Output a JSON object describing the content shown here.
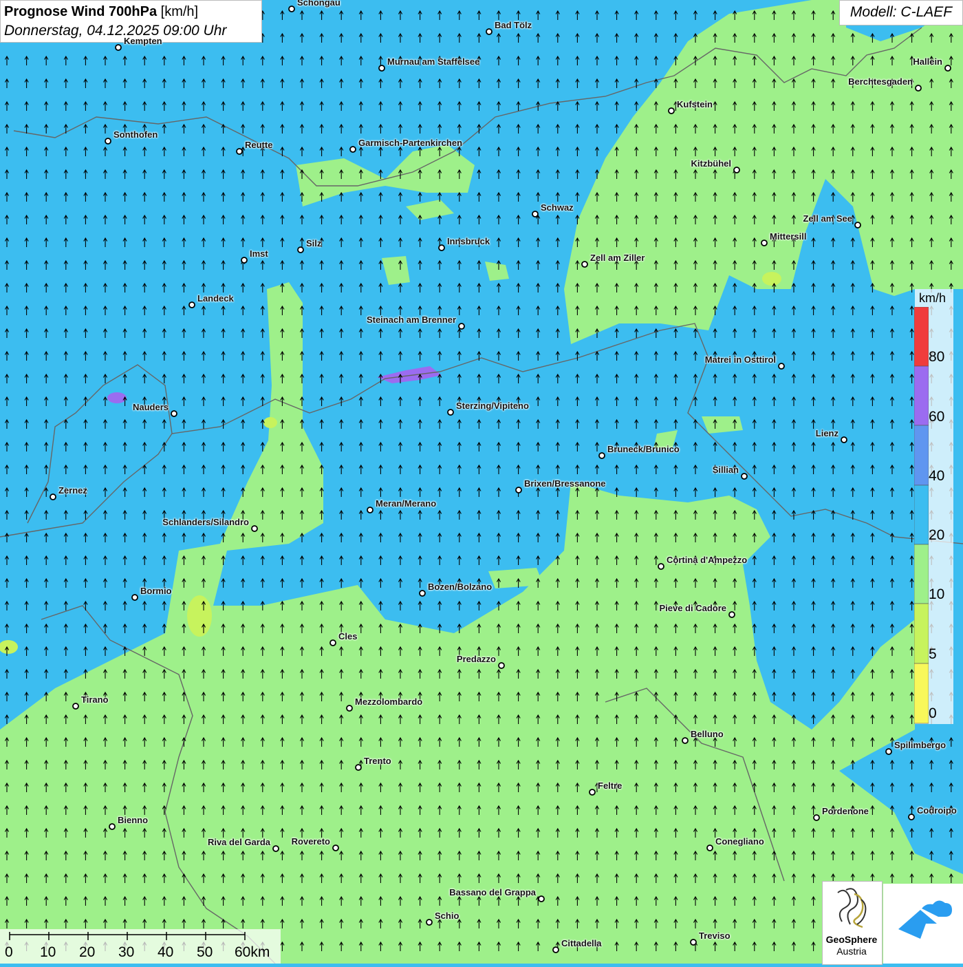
{
  "header": {
    "title_bold": "Prognose Wind 700hPa",
    "title_unit": "[km/h]",
    "subtitle": "Donnerstag, 04.12.2025 09:00 Uhr",
    "model": "Modell: C-LAEF"
  },
  "legend": {
    "unit": "km/h",
    "labels": [
      "80",
      "60",
      "40",
      "20",
      "10",
      "5",
      "0"
    ],
    "colors": {
      "0-5": "#f8f85a",
      "5-10": "#c7f35d",
      "10-20": "#9ef08a",
      "20-40": "#3cbdf0",
      "40-60": "#5f96f0",
      "60-80": "#9b6cf0",
      "80+": "#f03c3c"
    }
  },
  "scale_bar": {
    "labels": [
      "0",
      "10",
      "20",
      "30",
      "40",
      "50",
      "60km"
    ]
  },
  "logos": {
    "geosphere_line1": "GeoSphere",
    "geosphere_line2": "Austria",
    "geosphere_icon": "geosphere-swirl-icon",
    "partner_icon": "cloud-arrow-icon"
  },
  "cities": [
    {
      "name": "Schongau"
    },
    {
      "name": "Bad Tölz"
    },
    {
      "name": "Kempten"
    },
    {
      "name": "Murnau am Staffelsee"
    },
    {
      "name": "Hallein"
    },
    {
      "name": "Berchtesgaden"
    },
    {
      "name": "Kufstein"
    },
    {
      "name": "Sonthofen"
    },
    {
      "name": "Reutte"
    },
    {
      "name": "Garmisch-Partenkirchen"
    },
    {
      "name": "Kitzbühel"
    },
    {
      "name": "Schwaz"
    },
    {
      "name": "Zell am See"
    },
    {
      "name": "Mittersill"
    },
    {
      "name": "Innsbruck"
    },
    {
      "name": "Silz"
    },
    {
      "name": "Imst"
    },
    {
      "name": "Zell am Ziller"
    },
    {
      "name": "Landeck"
    },
    {
      "name": "Steinach am Brenner"
    },
    {
      "name": "Matrei in Osttirol"
    },
    {
      "name": "Nauders"
    },
    {
      "name": "Sterzing/Vipiteno"
    },
    {
      "name": "Lienz"
    },
    {
      "name": "Bruneck/Brunico"
    },
    {
      "name": "Sillian"
    },
    {
      "name": "Zernez"
    },
    {
      "name": "Brixen/Bressanone"
    },
    {
      "name": "Meran/Merano"
    },
    {
      "name": "Schlanders/Silandro"
    },
    {
      "name": "Cortina d'Ampezzo"
    },
    {
      "name": "Bormio"
    },
    {
      "name": "Bozen/Bolzano"
    },
    {
      "name": "Pieve di Cadore"
    },
    {
      "name": "Cles"
    },
    {
      "name": "Predazzo"
    },
    {
      "name": "Tirano"
    },
    {
      "name": "Mezzolombardo"
    },
    {
      "name": "Belluno"
    },
    {
      "name": "Spilimbergo"
    },
    {
      "name": "Trento"
    },
    {
      "name": "Feltre"
    },
    {
      "name": "Pordenone"
    },
    {
      "name": "Codroipo"
    },
    {
      "name": "Bienno"
    },
    {
      "name": "Riva del Garda"
    },
    {
      "name": "Rovereto"
    },
    {
      "name": "Conegliano"
    },
    {
      "name": "Bassano del Grappa"
    },
    {
      "name": "Schio"
    },
    {
      "name": "Treviso"
    },
    {
      "name": "Cittadella"
    }
  ]
}
